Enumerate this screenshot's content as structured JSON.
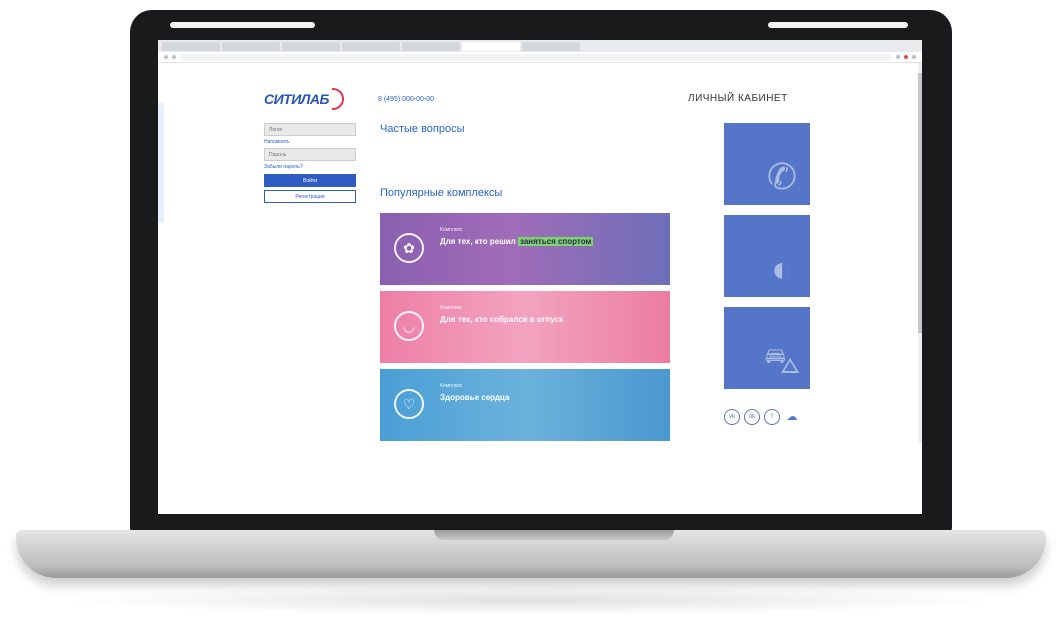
{
  "browser": {
    "tabs": [
      "",
      "",
      "",
      "",
      "",
      "",
      ""
    ],
    "address": ""
  },
  "header": {
    "logo": "СИТИЛАБ",
    "phone": "8 (495) 000-00-00",
    "cabinet": "ЛИЧНЫЙ КАБИНЕТ"
  },
  "login": {
    "login_placeholder": "Логин",
    "forgot_login": "Напомнить",
    "password_placeholder": "Пароль",
    "forgot_password": "Забыли пароль?",
    "login_button": "Войти",
    "register_button": "Регистрация"
  },
  "faq": {
    "title": "Частые вопросы",
    "items": [
      "",
      "",
      "",
      ""
    ]
  },
  "popular": {
    "title": "Популярные комплексы",
    "banners": [
      {
        "category": "Комплекс",
        "title_pre": "Для тех, кто решил ",
        "title_hl": "заняться спортом",
        "text": "",
        "icon": "✿"
      },
      {
        "category": "Комплекс",
        "title_pre": "Для тех, кто собрался в отпуск",
        "title_hl": "",
        "text": "",
        "icon": "◡"
      },
      {
        "category": "Комплекс",
        "title_pre": "Здоровье сердца",
        "title_hl": "",
        "text": "",
        "icon": "♡"
      }
    ],
    "footnote": "",
    "footnote_link": ""
  },
  "cards": [
    {
      "text": "",
      "icon": "✆"
    },
    {
      "text": "",
      "icon": "◐"
    },
    {
      "text": "",
      "icon": "⛍"
    }
  ],
  "social": {
    "label": "",
    "icons": [
      "vk",
      "ok",
      "f",
      "☁"
    ]
  },
  "colors": {
    "brand": "#2a55b8",
    "accent_red": "#e0324b",
    "card_blue": "#5576c8",
    "banner_purple": "#8a5fb0",
    "banner_pink": "#ee7fa6",
    "banner_blue": "#4a9ed6"
  }
}
